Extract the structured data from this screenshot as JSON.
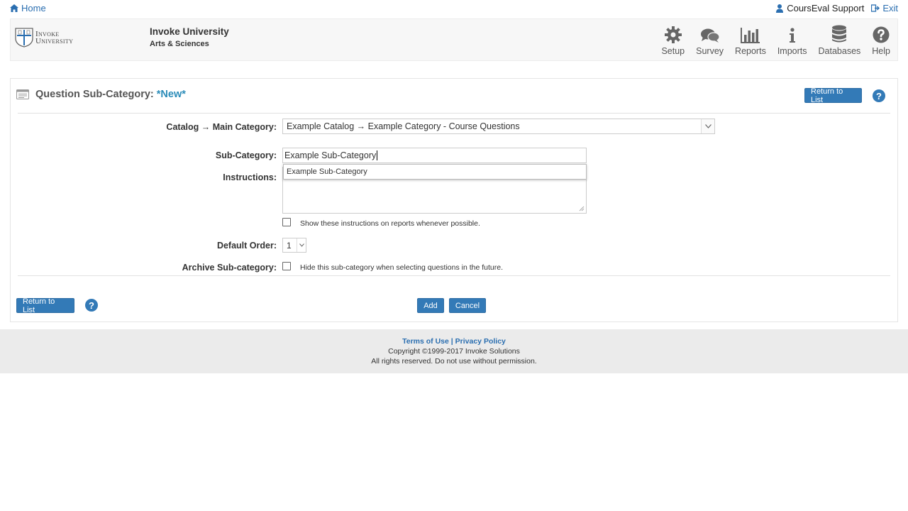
{
  "topbar": {
    "home_label": "Home",
    "user_label": "CoursEval Support",
    "exit_label": "Exit"
  },
  "header": {
    "logo_line1": "Invoke",
    "logo_line2": "University",
    "org_name": "Invoke University",
    "org_sub": "Arts & Sciences",
    "nav": [
      {
        "label": "Setup",
        "icon": "gear-icon"
      },
      {
        "label": "Survey",
        "icon": "comments-icon"
      },
      {
        "label": "Reports",
        "icon": "bar-chart-icon"
      },
      {
        "label": "Imports",
        "icon": "info-icon"
      },
      {
        "label": "Databases",
        "icon": "database-icon"
      },
      {
        "label": "Help",
        "icon": "question-icon"
      }
    ]
  },
  "form": {
    "title": "Question Sub-Category:",
    "title_status": "*New*",
    "return_label": "Return to List",
    "catalog_label": "Catalog → Main Category:",
    "catalog_value": "Example Catalog → Example Category - Course Questions",
    "subcategory_label": "Sub-Category:",
    "subcategory_value": "Example Sub-Category",
    "autocomplete_item": "Example Sub-Category",
    "instructions_label": "Instructions:",
    "show_instructions_text": "Show these instructions on reports whenever possible.",
    "default_order_label": "Default Order:",
    "default_order_value": "1",
    "archive_label": "Archive Sub-category:",
    "archive_text": "Hide this sub-category when selecting questions in the future.",
    "add_label": "Add",
    "cancel_label": "Cancel"
  },
  "footer": {
    "terms": "Terms of Use",
    "separator": "|",
    "privacy": "Privacy Policy",
    "copyright": "Copyright ©1999-2017 Invoke Solutions",
    "rights": "All rights reserved. Do not use without permission."
  },
  "colors": {
    "accent": "#337ab7",
    "link": "#2a6eb0",
    "status": "#2a8bb8"
  }
}
